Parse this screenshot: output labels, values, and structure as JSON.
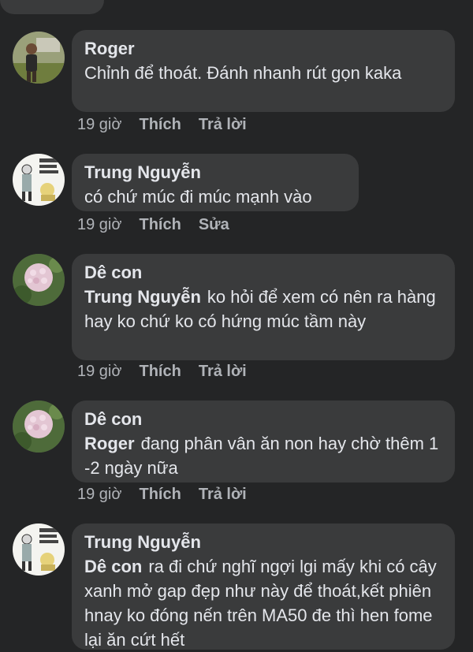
{
  "colors": {
    "background": "#242526",
    "bubble": "#3a3b3c",
    "text": "#e4e6eb",
    "meta": "#b0b3b8"
  },
  "comments": [
    {
      "author": "Roger",
      "text": "Chỉnh để thoát. Đánh nhanh rút gọn kaka",
      "time": "19 giờ",
      "like": "Thích",
      "action": "Trả lời",
      "avatar": "man-in-field-avatar"
    },
    {
      "author": "Trung Nguyễn",
      "text": "có chứ múc đi múc mạnh vào",
      "time": "19 giờ",
      "like": "Thích",
      "action": "Sửa",
      "avatar": "cartoon-meme-avatar"
    },
    {
      "author": "Dê con",
      "mention": "Trung Nguyễn",
      "text": "ko hỏi để xem có nên ra hàng hay ko chứ ko có hứng múc tầm này",
      "time": "19 giờ",
      "like": "Thích",
      "action": "Trả lời",
      "avatar": "hydrangea-flower-avatar"
    },
    {
      "author": "Dê con",
      "mention": "Roger",
      "text": "đang phân vân ăn non hay chờ thêm 1 -2 ngày nữa",
      "time": "19 giờ",
      "like": "Thích",
      "action": "Trả lời",
      "avatar": "hydrangea-flower-avatar"
    },
    {
      "author": "Trung Nguyễn",
      "mention": "Dê con",
      "text": "ra đi chứ nghĩ ngợi lgi mấy khi có cây xanh mở gap đẹp như này để thoát,kết phiên hnay ko đóng nến trên MA50 đe thì hen fome lại ăn cứt hết",
      "avatar": "cartoon-meme-avatar"
    }
  ]
}
